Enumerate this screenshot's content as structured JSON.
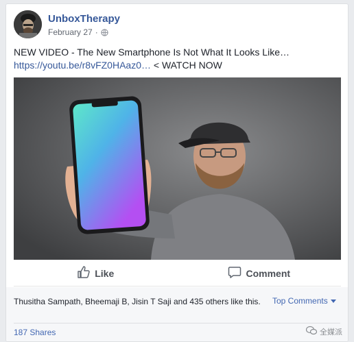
{
  "post": {
    "author": "UnboxTherapy",
    "date": "February 27",
    "date_separator": "·",
    "privacy_icon": "globe-icon",
    "text_line1": "NEW VIDEO - The New Smartphone Is Not What It Looks Like…",
    "link": "https://youtu.be/r8vFZ0HAaz0…",
    "link_suffix": " < WATCH NOW"
  },
  "actions": {
    "like_label": "Like",
    "like_icon": "thumbs-up-icon",
    "comment_label": "Comment",
    "comment_icon": "comment-bubble-icon"
  },
  "footer": {
    "reactions_text": "Thusitha Sampath, Bheemaji B, Jisin T Saji and 435 others like this.",
    "top_comments_label": "Top Comments",
    "shares_label": "187 Shares",
    "watermark_text": "全媒派"
  },
  "colors": {
    "author": "#365899",
    "link": "#365899",
    "accent": "#4267b2",
    "background": "#e9ebee"
  }
}
